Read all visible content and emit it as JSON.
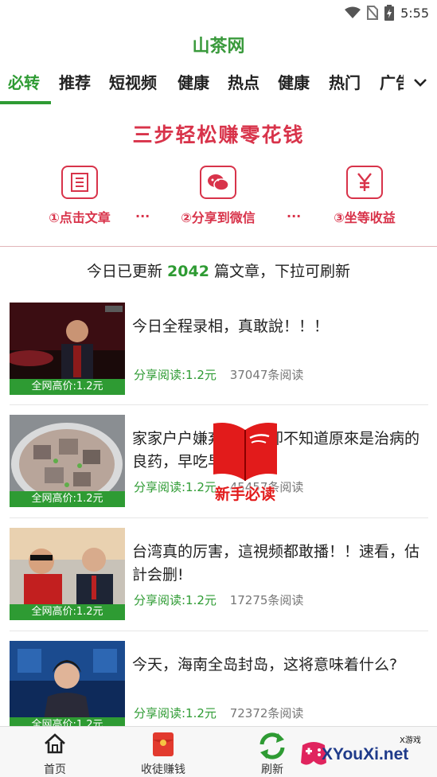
{
  "status_bar": {
    "time": "5:55"
  },
  "app": {
    "title": "山茶网"
  },
  "tabs": [
    {
      "label": "必转",
      "active": true
    },
    {
      "label": "推荐"
    },
    {
      "label": "短视频"
    },
    {
      "label": "健康"
    },
    {
      "label": "热点"
    },
    {
      "label": "健康"
    },
    {
      "label": "热门"
    },
    {
      "label": "广告"
    }
  ],
  "banner": {
    "title": "三步轻松赚零花钱",
    "steps": [
      {
        "label": "①点击文章",
        "icon": "article-icon"
      },
      {
        "label": "②分享到微信",
        "icon": "wechat-icon"
      },
      {
        "label": "③坐等收益",
        "icon": "yuan-icon"
      }
    ],
    "dots": "···"
  },
  "update": {
    "prefix": "今日已更新",
    "count": "2042",
    "suffix": "篇文章，下拉可刷新"
  },
  "articles": [
    {
      "title": "今日全程录相，真敢說！！！",
      "badge": "全网高价:1.2元",
      "reward": "分享阅读:1.2元",
      "reads": "37047条阅读"
    },
    {
      "title": "家家户户嫌弃的丑，却不知道原來是治病的良药，早吃早受益！",
      "badge": "全网高价:1.2元",
      "reward": "分享阅读:1.2元",
      "reads": "45457条阅读"
    },
    {
      "title": "台湾真的厉害，這視频都敢播！！速看，估計会删!",
      "badge": "全网高价:1.2元",
      "reward": "分享阅读:1.2元",
      "reads": "17275条阅读"
    },
    {
      "title": "今天，海南全岛封岛，这将意味着什么?",
      "badge": "全网高价:1.2元",
      "reward": "分享阅读:1.2元",
      "reads": "72372条阅读"
    }
  ],
  "floating": {
    "label": "新手必读"
  },
  "bottom_nav": [
    {
      "label": "首页",
      "icon": "home-icon"
    },
    {
      "label": "收徒赚钱",
      "icon": "red-envelope-icon"
    },
    {
      "label": "刷新",
      "icon": "refresh-icon"
    }
  ],
  "watermark": {
    "text": "XYouXi.net",
    "sub": "X游戏"
  },
  "colors": {
    "brand_green": "#2e9b33",
    "banner_red": "#d8334a"
  }
}
